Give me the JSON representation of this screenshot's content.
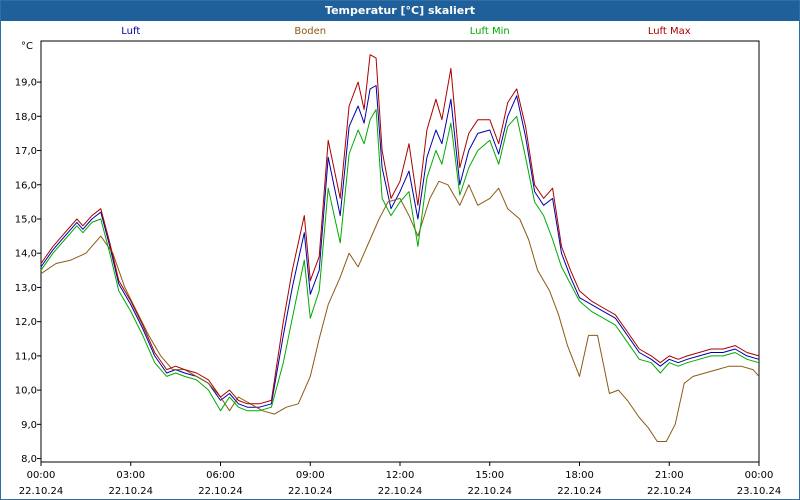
{
  "window": {
    "title": "Temperatur [°C] skaliert"
  },
  "chart_data": {
    "type": "line",
    "title": "Temperatur [°C] skaliert",
    "ylabel": "°C",
    "ylim": [
      7.9,
      20.2
    ],
    "xlim": [
      0,
      24
    ],
    "grid": true,
    "legend_position": "top",
    "y_ticks": [
      "8,0",
      "9,0",
      "10,0",
      "11,0",
      "12,0",
      "13,0",
      "14,0",
      "15,0",
      "16,0",
      "17,0",
      "18,0",
      "19,0"
    ],
    "x_ticks": [
      {
        "time": "00:00",
        "date": "22.10.24"
      },
      {
        "time": "03:00",
        "date": "22.10.24"
      },
      {
        "time": "06:00",
        "date": "22.10.24"
      },
      {
        "time": "09:00",
        "date": "22.10.24"
      },
      {
        "time": "12:00",
        "date": "22.10.24"
      },
      {
        "time": "15:00",
        "date": "22.10.24"
      },
      {
        "time": "18:00",
        "date": "22.10.24"
      },
      {
        "time": "21:00",
        "date": "22.10.24"
      },
      {
        "time": "00:00",
        "date": "23.10.24"
      }
    ],
    "series": [
      {
        "name": "Luft",
        "color": "#0000aa",
        "x": [
          0,
          0.4,
          0.8,
          1.2,
          1.4,
          1.7,
          2.0,
          2.3,
          2.6,
          3.0,
          3.4,
          3.8,
          4.2,
          4.5,
          4.8,
          5.2,
          5.6,
          6.0,
          6.3,
          6.6,
          6.9,
          7.3,
          7.7,
          8.1,
          8.4,
          8.8,
          9.0,
          9.3,
          9.6,
          10.0,
          10.3,
          10.6,
          10.8,
          11.0,
          11.2,
          11.4,
          11.7,
          12.0,
          12.3,
          12.6,
          12.9,
          13.2,
          13.4,
          13.7,
          14.0,
          14.3,
          14.6,
          15.0,
          15.3,
          15.6,
          15.9,
          16.2,
          16.5,
          16.8,
          17.1,
          17.4,
          17.7,
          18.0,
          18.4,
          18.8,
          19.2,
          19.6,
          20.0,
          20.4,
          20.7,
          21.0,
          21.3,
          21.6,
          22.0,
          22.4,
          22.8,
          23.2,
          23.6,
          24.0
        ],
        "values": [
          13.6,
          14.1,
          14.5,
          14.9,
          14.7,
          15.0,
          15.2,
          14.2,
          13.1,
          12.5,
          11.8,
          11.0,
          10.5,
          10.6,
          10.5,
          10.4,
          10.2,
          9.7,
          9.9,
          9.6,
          9.5,
          9.5,
          9.6,
          11.6,
          13.0,
          14.6,
          12.8,
          13.5,
          16.8,
          15.1,
          17.7,
          18.3,
          17.8,
          18.8,
          18.9,
          16.5,
          15.3,
          15.8,
          16.4,
          15.0,
          16.8,
          17.6,
          17.2,
          18.5,
          16.0,
          17.0,
          17.5,
          17.6,
          16.9,
          18.0,
          18.6,
          17.4,
          15.8,
          15.4,
          15.6,
          14.0,
          13.3,
          12.7,
          12.5,
          12.3,
          12.1,
          11.6,
          11.1,
          10.9,
          10.7,
          10.9,
          10.8,
          10.9,
          11.0,
          11.1,
          11.1,
          11.2,
          11.0,
          10.9
        ]
      },
      {
        "name": "Boden",
        "color": "#8b5a14",
        "x": [
          0,
          0.5,
          1.0,
          1.5,
          2.0,
          2.4,
          2.8,
          3.2,
          3.6,
          4.0,
          4.4,
          4.8,
          5.2,
          5.6,
          6.0,
          6.3,
          6.6,
          7.0,
          7.4,
          7.8,
          8.2,
          8.6,
          9.0,
          9.3,
          9.6,
          10.0,
          10.3,
          10.6,
          11.0,
          11.3,
          11.6,
          12.0,
          12.3,
          12.6,
          13.0,
          13.3,
          13.6,
          14.0,
          14.3,
          14.6,
          15.0,
          15.3,
          15.6,
          16.0,
          16.3,
          16.6,
          17.0,
          17.3,
          17.6,
          18.0,
          18.3,
          18.6,
          19.0,
          19.3,
          19.6,
          20.0,
          20.3,
          20.6,
          20.9,
          21.2,
          21.5,
          21.8,
          22.2,
          22.6,
          23.0,
          23.4,
          23.8,
          24.0
        ],
        "values": [
          13.4,
          13.7,
          13.8,
          14.0,
          14.5,
          14.0,
          13.0,
          12.3,
          11.6,
          11.0,
          10.6,
          10.6,
          10.4,
          10.2,
          9.8,
          9.4,
          9.8,
          9.6,
          9.4,
          9.3,
          9.5,
          9.6,
          10.4,
          11.5,
          12.5,
          13.3,
          14.0,
          13.6,
          14.4,
          15.0,
          15.5,
          15.6,
          15.1,
          14.5,
          15.6,
          16.1,
          16.0,
          15.4,
          16.0,
          15.4,
          15.6,
          15.9,
          15.3,
          15.0,
          14.4,
          13.5,
          12.9,
          12.2,
          11.3,
          10.4,
          11.6,
          11.6,
          9.9,
          10.0,
          9.7,
          9.2,
          8.9,
          8.5,
          8.5,
          9.0,
          10.2,
          10.4,
          10.5,
          10.6,
          10.7,
          10.7,
          10.6,
          10.4
        ]
      },
      {
        "name": "Luft Min",
        "color": "#00aa00",
        "x": [
          0,
          0.4,
          0.8,
          1.2,
          1.4,
          1.7,
          2.0,
          2.3,
          2.6,
          3.0,
          3.4,
          3.8,
          4.2,
          4.5,
          4.8,
          5.2,
          5.6,
          6.0,
          6.3,
          6.6,
          6.9,
          7.3,
          7.7,
          8.1,
          8.4,
          8.8,
          9.0,
          9.3,
          9.6,
          10.0,
          10.3,
          10.6,
          10.8,
          11.0,
          11.2,
          11.4,
          11.7,
          12.0,
          12.3,
          12.6,
          12.9,
          13.2,
          13.4,
          13.7,
          14.0,
          14.3,
          14.6,
          15.0,
          15.3,
          15.6,
          15.9,
          16.2,
          16.5,
          16.8,
          17.1,
          17.4,
          17.7,
          18.0,
          18.4,
          18.8,
          19.2,
          19.6,
          20.0,
          20.4,
          20.7,
          21.0,
          21.3,
          21.6,
          22.0,
          22.4,
          22.8,
          23.2,
          23.6,
          24.0
        ],
        "values": [
          13.5,
          14.0,
          14.4,
          14.8,
          14.6,
          14.9,
          15.0,
          14.0,
          12.9,
          12.3,
          11.6,
          10.8,
          10.4,
          10.5,
          10.4,
          10.3,
          10.0,
          9.4,
          9.8,
          9.5,
          9.4,
          9.4,
          9.5,
          10.8,
          12.1,
          13.8,
          12.1,
          12.9,
          15.9,
          14.3,
          16.9,
          17.6,
          17.2,
          17.9,
          18.2,
          15.6,
          15.1,
          15.5,
          15.8,
          14.2,
          16.2,
          17.0,
          16.6,
          17.8,
          15.7,
          16.5,
          17.0,
          17.3,
          16.6,
          17.7,
          18.0,
          16.8,
          15.5,
          15.1,
          14.4,
          13.6,
          13.1,
          12.6,
          12.3,
          12.1,
          11.9,
          11.4,
          10.9,
          10.8,
          10.5,
          10.8,
          10.7,
          10.8,
          10.9,
          11.0,
          11.0,
          11.1,
          10.9,
          10.8
        ]
      },
      {
        "name": "Luft Max",
        "color": "#aa0000",
        "x": [
          0,
          0.4,
          0.8,
          1.2,
          1.4,
          1.7,
          2.0,
          2.3,
          2.6,
          3.0,
          3.4,
          3.8,
          4.2,
          4.5,
          4.8,
          5.2,
          5.6,
          6.0,
          6.3,
          6.6,
          6.9,
          7.3,
          7.7,
          8.1,
          8.4,
          8.8,
          9.0,
          9.3,
          9.6,
          10.0,
          10.3,
          10.6,
          10.8,
          11.0,
          11.2,
          11.4,
          11.7,
          12.0,
          12.3,
          12.6,
          12.9,
          13.2,
          13.4,
          13.7,
          14.0,
          14.3,
          14.6,
          15.0,
          15.3,
          15.6,
          15.9,
          16.2,
          16.5,
          16.8,
          17.1,
          17.4,
          17.7,
          18.0,
          18.4,
          18.8,
          19.2,
          19.6,
          20.0,
          20.4,
          20.7,
          21.0,
          21.3,
          21.6,
          22.0,
          22.4,
          22.8,
          23.2,
          23.6,
          24.0
        ],
        "values": [
          13.7,
          14.2,
          14.6,
          15.0,
          14.8,
          15.1,
          15.3,
          14.3,
          13.2,
          12.6,
          11.9,
          11.1,
          10.6,
          10.7,
          10.6,
          10.5,
          10.3,
          9.8,
          10.0,
          9.7,
          9.6,
          9.6,
          9.7,
          12.0,
          13.5,
          15.1,
          13.2,
          13.9,
          17.3,
          15.6,
          18.3,
          19.0,
          18.2,
          19.8,
          19.7,
          17.0,
          15.6,
          16.1,
          17.2,
          15.4,
          17.6,
          18.5,
          17.9,
          19.4,
          16.5,
          17.5,
          17.9,
          17.9,
          17.2,
          18.4,
          18.8,
          17.7,
          16.0,
          15.6,
          15.9,
          14.2,
          13.5,
          12.9,
          12.6,
          12.4,
          12.2,
          11.7,
          11.2,
          11.0,
          10.8,
          11.0,
          10.9,
          11.0,
          11.1,
          11.2,
          11.2,
          11.3,
          11.1,
          11.0
        ]
      }
    ]
  }
}
